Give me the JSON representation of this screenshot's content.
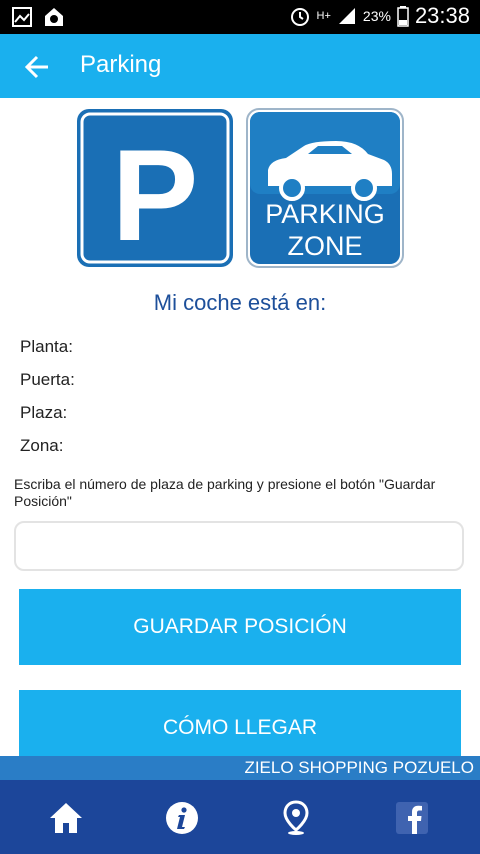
{
  "status": {
    "time": "23:38",
    "battery": "23%",
    "network": "H+"
  },
  "appbar": {
    "title": "Parking"
  },
  "signs": {
    "zone_line1": "PARKING",
    "zone_line2": "ZONE",
    "p_letter": "P"
  },
  "main": {
    "heading": "Mi coche está en:",
    "fields": [
      "Planta:",
      "Puerta:",
      "Plaza:",
      "Zona:"
    ],
    "instruction": "Escriba el número de plaza de parking y presione el botón \"Guardar Posición\"",
    "input_value": "",
    "save_button": "GUARDAR POSICIÓN",
    "directions_button": "CÓMO LLEGAR"
  },
  "footer": {
    "mall_name": "ZIELO SHOPPING POZUELO"
  },
  "nav": {
    "items": [
      "home-icon",
      "info-icon",
      "location-pin-icon",
      "facebook-icon"
    ]
  },
  "colors": {
    "accent": "#1ab0ee",
    "nav": "#1c469a",
    "strip": "#2a7dc6",
    "heading": "#1d4f9a"
  }
}
